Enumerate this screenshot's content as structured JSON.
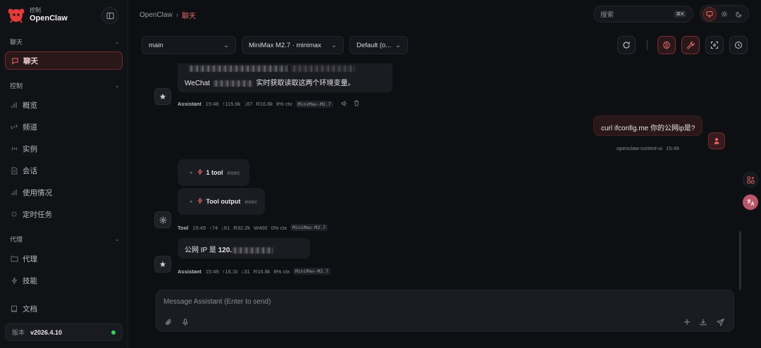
{
  "brand": {
    "sub": "控制",
    "name": "OpenClaw"
  },
  "sidebar": {
    "sections": [
      {
        "label": "聊天"
      },
      {
        "label": "控制"
      },
      {
        "label": "代理"
      }
    ],
    "items": [
      {
        "label": "聊天",
        "icon": "message-icon"
      },
      {
        "label": "概览",
        "icon": "bar-chart-icon"
      },
      {
        "label": "频道",
        "icon": "link-icon"
      },
      {
        "label": "实例",
        "icon": "broadcast-icon"
      },
      {
        "label": "会话",
        "icon": "document-icon"
      },
      {
        "label": "使用情况",
        "icon": "bar-chart-icon"
      },
      {
        "label": "定时任务",
        "icon": "loader-icon"
      },
      {
        "label": "代理",
        "icon": "folder-icon"
      },
      {
        "label": "技能",
        "icon": "zap-icon"
      },
      {
        "label": "文档",
        "icon": "book-icon"
      }
    ],
    "version_label": "版本",
    "version_value": "v2026.4.10",
    "status_color": "#2dd35a"
  },
  "breadcrumb": {
    "root": "OpenClaw",
    "sep": "›",
    "current": "聊天"
  },
  "search": {
    "placeholder": "搜索",
    "shortcut": "⌘K"
  },
  "controls": {
    "session": "main",
    "model": "MiniMax M2.7 · minimax",
    "mode": "Default (o..."
  },
  "messages": {
    "m1": {
      "text_visible": "WeChat",
      "text_tail": "实时获取读取这两个环境变量。",
      "meta": {
        "who": "Assistant",
        "time": "15:48",
        "up": "↑115.9k",
        "down": "↓87",
        "r": "R16.8k",
        "ctx": "8% ctx",
        "model": "MiniMax-M2.7"
      }
    },
    "m2": {
      "text": "curl ifconfig.me 你的公网ip是?",
      "meta": {
        "who": "openclaw-control-ui",
        "time": "15:49"
      }
    },
    "tool1": {
      "title": "1 tool",
      "tag": "exec"
    },
    "tool2": {
      "title": "Tool output",
      "tag": "exec"
    },
    "m3meta": {
      "who": "Tool",
      "time": "15:49",
      "up": "↑74",
      "down": "↓61",
      "r": "R32.2k",
      "w": "W400",
      "ctx": "0% ctx",
      "model": "MiniMax-M2.7"
    },
    "m4": {
      "text_prefix": "公网 IP 是 ",
      "text_bold": "120.",
      "meta": {
        "who": "Assistant",
        "time": "15:49",
        "up": "↑16.1k",
        "down": "↓31",
        "r": "R16.8k",
        "ctx": "8% ctx",
        "model": "MiniMax-M2.7"
      }
    }
  },
  "composer": {
    "placeholder": "Message Assistant (Enter to send)"
  },
  "colors": {
    "accent": "#e46a6a",
    "bg": "#0e0f12"
  }
}
